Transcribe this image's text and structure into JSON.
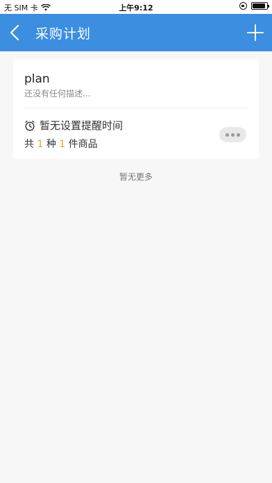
{
  "status_bar": {
    "carrier": "无 SIM 卡",
    "time": "上午9:12"
  },
  "nav": {
    "title": "采购计划"
  },
  "plan_card": {
    "name": "plan",
    "description": "还没有任何描述...",
    "reminder": "暂无设置提醒时间",
    "count_prefix": "共",
    "kind_count": "1",
    "kind_unit": "种",
    "item_count": "1",
    "item_unit": "件商品"
  },
  "footer": {
    "no_more": "暂无更多"
  }
}
